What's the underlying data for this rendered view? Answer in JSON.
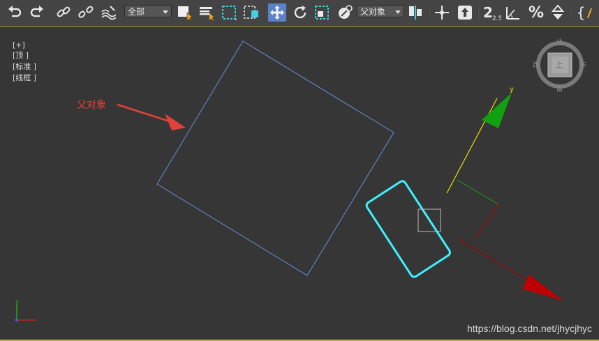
{
  "toolbar": {
    "selection_filter": "全部",
    "reference_coord": "父对象",
    "snap_label": "2.5",
    "percent_glyph": "%",
    "brace_glyph": "{"
  },
  "viewport": {
    "labels": [
      "[+]",
      "[顶 ]",
      "[标准 ]",
      "[线框 ]"
    ],
    "annotation": "父对象",
    "gizmo_axis_label": "y",
    "compass": {
      "north": "北",
      "south": "南",
      "east": "东",
      "west": "西",
      "cube_face": "上"
    },
    "corner_axis_label": "y",
    "watermark": "https://blog.csdn.net/jhycjhyc"
  },
  "colors": {
    "parent_outline": "#6b8fd6",
    "child_selected": "#3ff0ff",
    "annotation": "#e0413a",
    "gizmo_y": "#10a010",
    "gizmo_x": "#c00000",
    "viewport_border": "#c9a94a"
  }
}
